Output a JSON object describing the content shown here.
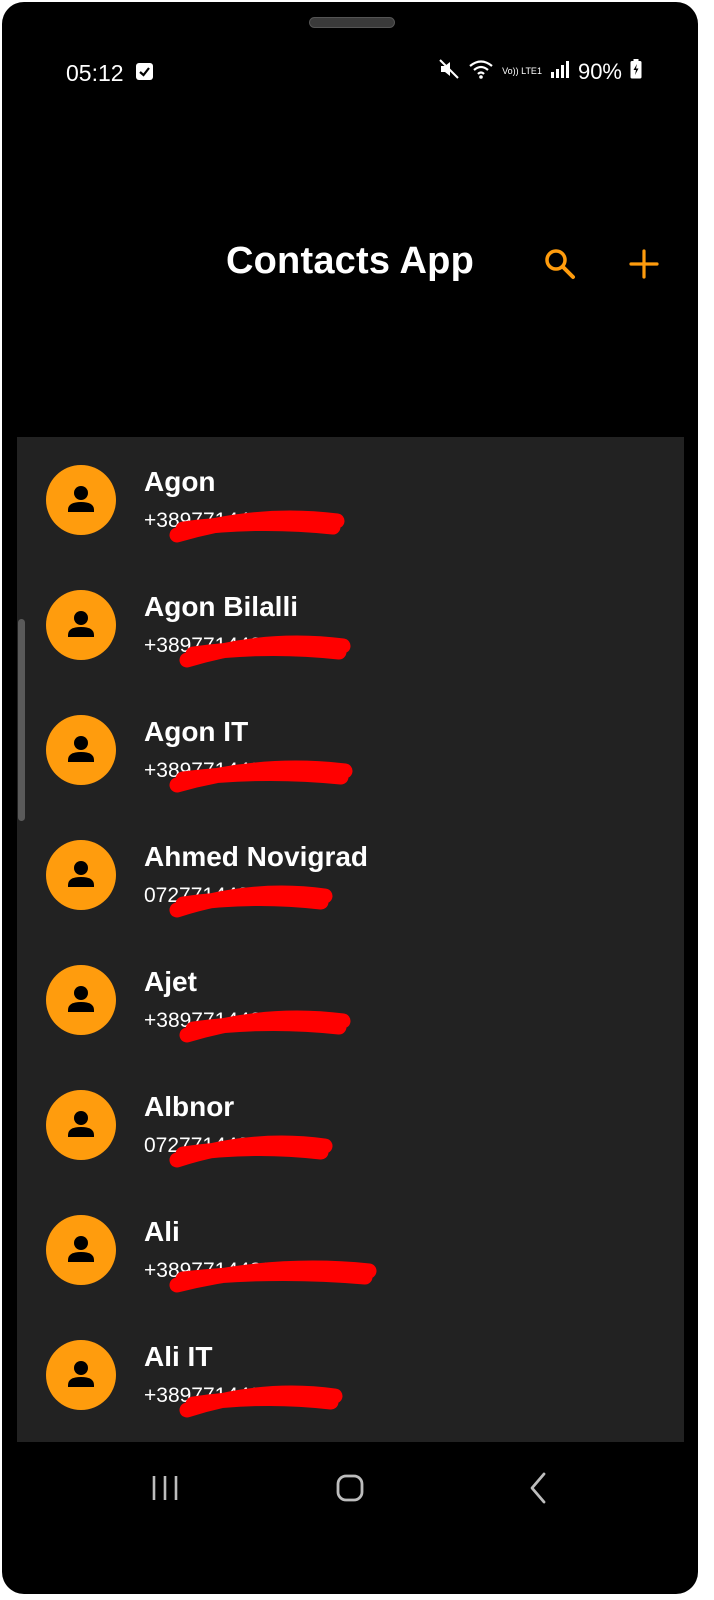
{
  "status_bar": {
    "time": "05:12",
    "network_label": "Vo)) LTE1",
    "battery": "90%"
  },
  "app_bar": {
    "title": "Contacts App",
    "search_icon": "search-icon",
    "add_icon": "plus-icon"
  },
  "colors": {
    "accent": "#FF9C0D",
    "list_background": "#222222",
    "screen_background": "#000000",
    "redaction": "#FF0000"
  },
  "contacts": [
    {
      "name": "Agon",
      "phone": "+3897714488"
    },
    {
      "name": "Agon Bilalli",
      "phone": "+3897714488"
    },
    {
      "name": "Agon IT",
      "phone": "+3897714488"
    },
    {
      "name": "Ahmed Novigrad",
      "phone": "0727714488"
    },
    {
      "name": "Ajet",
      "phone": "+3897714488"
    },
    {
      "name": "Albnor",
      "phone": "0727714488"
    },
    {
      "name": "Ali",
      "phone": "+3897714488"
    },
    {
      "name": "Ali IT",
      "phone": "+3897714488"
    }
  ],
  "nav_bar": {
    "recents_icon": "recents-icon",
    "home_icon": "home-icon",
    "back_icon": "back-icon"
  }
}
